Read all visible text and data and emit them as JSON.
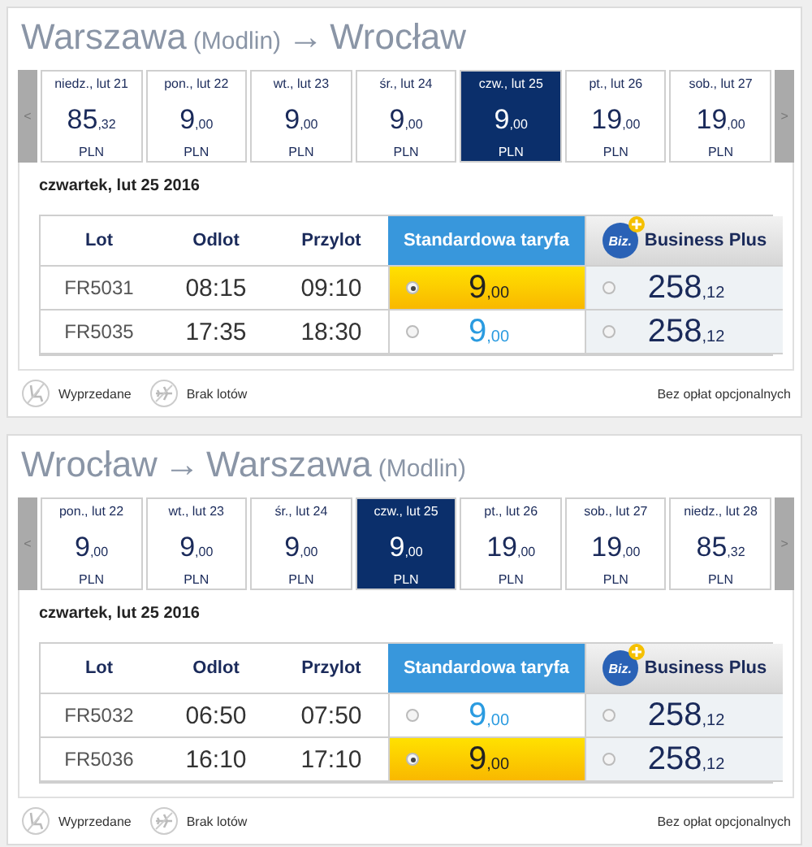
{
  "sections": [
    {
      "title": [
        {
          "text": "Warszawa",
          "kind": "city"
        },
        {
          "text": "(Modlin)",
          "kind": "note"
        },
        {
          "text": "→",
          "kind": "arrow"
        },
        {
          "text": "Wrocław",
          "kind": "city"
        }
      ],
      "prev": "<",
      "next": ">",
      "days": [
        {
          "label": "niedz., lut 21",
          "whole": "85",
          "decimal": ",32",
          "currency": "PLN",
          "selected": false
        },
        {
          "label": "pon., lut 22",
          "whole": "9",
          "decimal": ",00",
          "currency": "PLN",
          "selected": false
        },
        {
          "label": "wt., lut 23",
          "whole": "9",
          "decimal": ",00",
          "currency": "PLN",
          "selected": false
        },
        {
          "label": "śr., lut 24",
          "whole": "9",
          "decimal": ",00",
          "currency": "PLN",
          "selected": false
        },
        {
          "label": "czw., lut 25",
          "whole": "9",
          "decimal": ",00",
          "currency": "PLN",
          "selected": true
        },
        {
          "label": "pt., lut 26",
          "whole": "19",
          "decimal": ",00",
          "currency": "PLN",
          "selected": false
        },
        {
          "label": "sob., lut 27",
          "whole": "19",
          "decimal": ",00",
          "currency": "PLN",
          "selected": false
        }
      ],
      "date": "czwartek, lut 25 2016",
      "columns": [
        {
          "label": "Lot",
          "kind": "plain"
        },
        {
          "label": "Odlot",
          "kind": "plain"
        },
        {
          "label": "Przylot",
          "kind": "plain"
        },
        {
          "label": "Standardowa taryfa",
          "kind": "standard"
        },
        {
          "label": "Business Plus",
          "kind": "business",
          "logo": "Biz."
        }
      ],
      "rows": [
        {
          "flight": "FR5031",
          "departure": "08:15",
          "arrival": "09:10",
          "fares": [
            {
              "whole": "9",
              "decimal": ",00",
              "selected": true
            },
            {
              "whole": "258",
              "decimal": ",12",
              "selected": false
            }
          ]
        },
        {
          "flight": "FR5035",
          "departure": "17:35",
          "arrival": "18:30",
          "fares": [
            {
              "whole": "9",
              "decimal": ",00",
              "selected": false
            },
            {
              "whole": "258",
              "decimal": ",12",
              "selected": false
            }
          ]
        }
      ],
      "legend": [
        {
          "label": "Wyprzedane",
          "kind": "seat"
        },
        {
          "label": "Brak lotów",
          "kind": "plane"
        }
      ],
      "note": "Bez opłat opcjonalnych"
    },
    {
      "title": [
        {
          "text": "Wrocław",
          "kind": "city"
        },
        {
          "text": "→",
          "kind": "arrow"
        },
        {
          "text": "Warszawa",
          "kind": "city"
        },
        {
          "text": "(Modlin)",
          "kind": "note"
        }
      ],
      "prev": "<",
      "next": ">",
      "days": [
        {
          "label": "pon., lut 22",
          "whole": "9",
          "decimal": ",00",
          "currency": "PLN",
          "selected": false
        },
        {
          "label": "wt., lut 23",
          "whole": "9",
          "decimal": ",00",
          "currency": "PLN",
          "selected": false
        },
        {
          "label": "śr., lut 24",
          "whole": "9",
          "decimal": ",00",
          "currency": "PLN",
          "selected": false
        },
        {
          "label": "czw., lut 25",
          "whole": "9",
          "decimal": ",00",
          "currency": "PLN",
          "selected": true
        },
        {
          "label": "pt., lut 26",
          "whole": "19",
          "decimal": ",00",
          "currency": "PLN",
          "selected": false
        },
        {
          "label": "sob., lut 27",
          "whole": "19",
          "decimal": ",00",
          "currency": "PLN",
          "selected": false
        },
        {
          "label": "niedz., lut 28",
          "whole": "85",
          "decimal": ",32",
          "currency": "PLN",
          "selected": false
        }
      ],
      "date": "czwartek, lut 25 2016",
      "columns": [
        {
          "label": "Lot",
          "kind": "plain"
        },
        {
          "label": "Odlot",
          "kind": "plain"
        },
        {
          "label": "Przylot",
          "kind": "plain"
        },
        {
          "label": "Standardowa taryfa",
          "kind": "standard"
        },
        {
          "label": "Business Plus",
          "kind": "business",
          "logo": "Biz."
        }
      ],
      "rows": [
        {
          "flight": "FR5032",
          "departure": "06:50",
          "arrival": "07:50",
          "fares": [
            {
              "whole": "9",
              "decimal": ",00",
              "selected": false
            },
            {
              "whole": "258",
              "decimal": ",12",
              "selected": false
            }
          ]
        },
        {
          "flight": "FR5036",
          "departure": "16:10",
          "arrival": "17:10",
          "fares": [
            {
              "whole": "9",
              "decimal": ",00",
              "selected": true
            },
            {
              "whole": "258",
              "decimal": ",12",
              "selected": false
            }
          ]
        }
      ],
      "legend": [
        {
          "label": "Wyprzedane",
          "kind": "seat"
        },
        {
          "label": "Brak lotów",
          "kind": "plane"
        }
      ],
      "note": "Bez opłat opcjonalnych"
    }
  ]
}
